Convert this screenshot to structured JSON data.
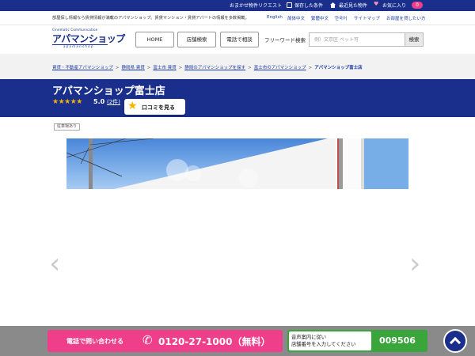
{
  "top_strip": {
    "links": [
      {
        "label": "おまかせ物件リクエスト",
        "icon": null
      },
      {
        "label": "保存した条件",
        "icon": "edit-icon"
      },
      {
        "label": "最近見た物件",
        "icon": "home-icon"
      },
      {
        "label": "お気に入り",
        "icon": "heart-icon"
      }
    ],
    "favorites_count": "0"
  },
  "intro": {
    "text": "部屋探し情報なら賃貸情報が満載のアパマンショップ。賃貸マンション・賃貸アパートの情報を多数掲載。",
    "languages": [
      "English",
      "简体中文",
      "繁體中文",
      "한국어",
      "サイトマップ",
      "お部屋を貸したい方"
    ]
  },
  "header": {
    "logo_small": "Cinematic Communication",
    "logo_main": "アパマンショップ",
    "logo_sub": "a p a m a n s h o p",
    "nav": [
      "HOME",
      "店舗検索",
      "電話で相談"
    ],
    "search_label": "フリーワード検索",
    "search_placeholder": "例）文京区 ペット可",
    "search_button": "検索"
  },
  "breadcrumb": [
    "賃貸・不動産アパマンショップ",
    "静岡県 賃貸",
    "富士市 賃貸",
    "静岡のアパマンショップを探す",
    "富士市のアパマンショップ",
    "アパマンショップ富士店"
  ],
  "shop": {
    "name": "アパマンショップ富士店",
    "stars": "★★★★★",
    "rating": "5.0",
    "review_count": "(2件)",
    "review_button": "口コミを見る",
    "tag": "駐車場あり"
  },
  "gallery": {
    "prev": "‹",
    "next": "›"
  },
  "bottom": {
    "call_label": "電話で問い合わせる",
    "phone": "0120-27-1000（無料）",
    "voice_note_line1": "音声案内に従い",
    "voice_note_line2": "店舗番号を入力してください",
    "shop_code": "009506"
  },
  "colors": {
    "brand_navy": "#1a2f8c",
    "call_pink": "#ef3f8b",
    "code_green": "#3aa53a",
    "star_gold": "#f5b400"
  }
}
